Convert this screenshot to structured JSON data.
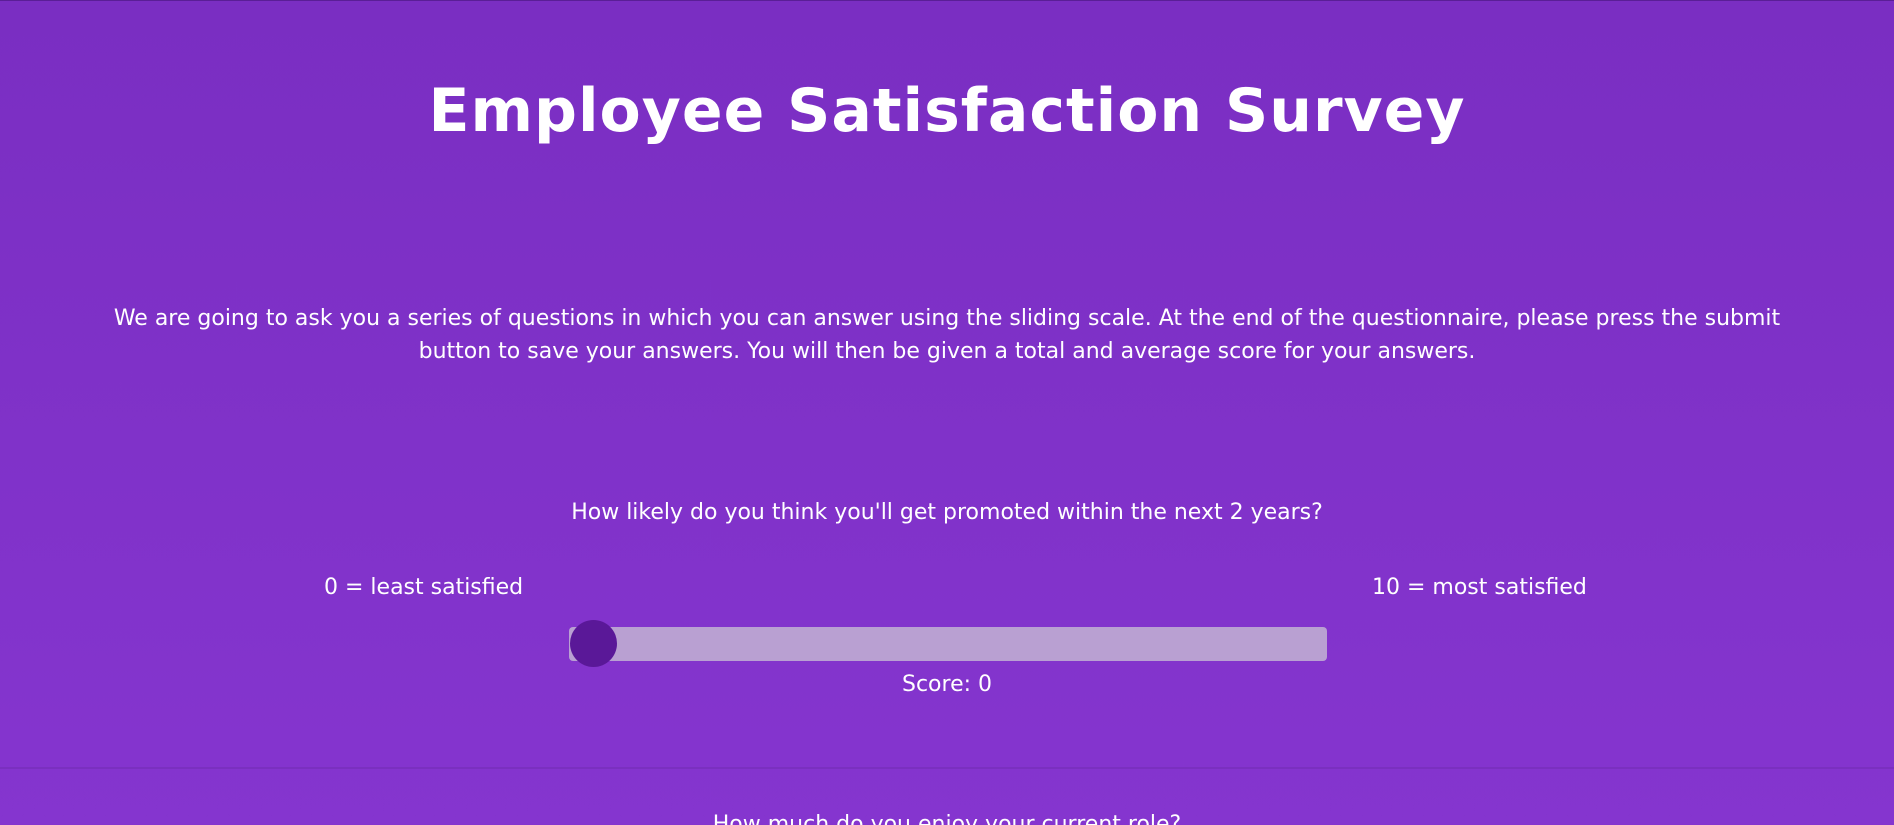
{
  "page": {
    "title": "Employee Satisfaction Survey",
    "intro": "We are going to ask you a series of questions in which you can answer using the sliding scale. At the end of the questionnaire, please press the submit button to save your answers. You will then be given a total and average score for your answers."
  },
  "questions": [
    {
      "text": "How likely do you think you'll get promoted within the next 2 years?",
      "min_label": "0 = least satisfied",
      "max_label": "10 = most satisfied",
      "slider": {
        "min": 0,
        "max": 10,
        "value": 0
      },
      "score_text": "Score: 0"
    },
    {
      "text": "How much do you enjoy your current role?"
    }
  ],
  "colors": {
    "background_top": "#7a2ec2",
    "background_bottom": "#8535cf",
    "slider_track": "#b9a0d2",
    "slider_thumb": "#5a1898",
    "text": "#ffffff"
  }
}
